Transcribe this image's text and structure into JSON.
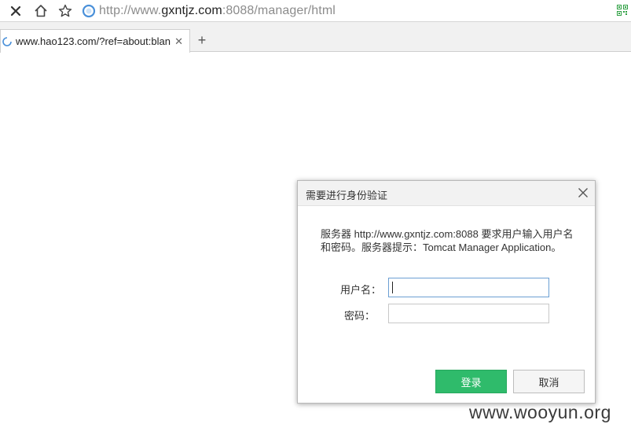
{
  "browser": {
    "url": {
      "scheme": "http://www.",
      "domain": "gxntjz.com",
      "rest": ":8088/manager/html"
    },
    "tab": {
      "title": "www.hao123.com/?ref=about:blan"
    },
    "icons": [
      "close-icon",
      "home-icon",
      "star-icon",
      "globe-icon",
      "qr-code-icon",
      "loading-icon",
      "plus-icon"
    ]
  },
  "dialog": {
    "title": "需要进行身份验证",
    "message_line1": "服务器 http://www.gxntjz.com:8088 要求用户输入用户名",
    "message_line2": "和密码。服务器提示：Tomcat Manager Application。",
    "username_label": "用户名：",
    "password_label": "密码：",
    "username_value": "",
    "password_value": "",
    "login_label": "登录",
    "cancel_label": "取消"
  },
  "colors": {
    "login_button": "#2fbb6b",
    "focus_border": "#6c9fd3",
    "qr_green": "#2ea043",
    "globe_blue": "#4a90d9"
  },
  "watermark": "www.wooyun.org"
}
